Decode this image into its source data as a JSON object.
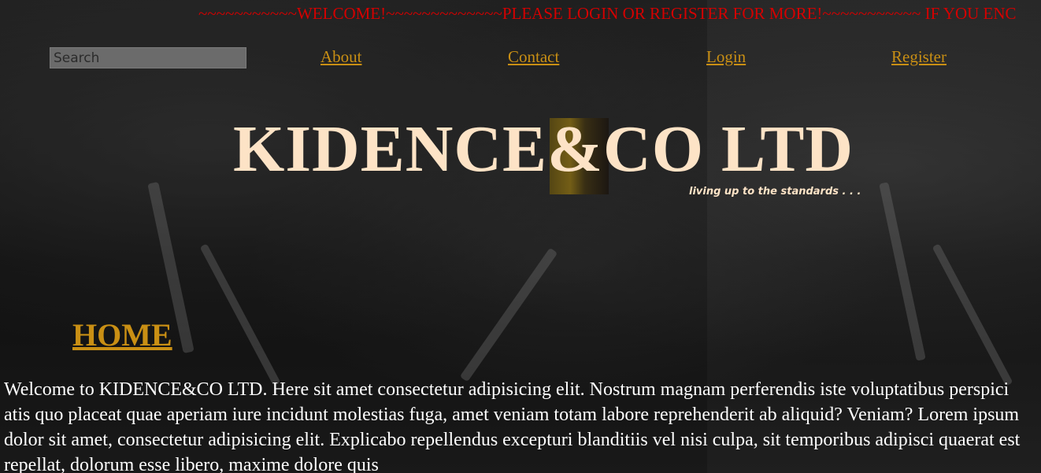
{
  "marquee": {
    "text": "~~~~~~~~~~~WELCOME!~~~~~~~~~~~~~PLEASE LOGIN OR REGISTER FOR MORE!~~~~~~~~~~~ IF YOU ENC"
  },
  "search": {
    "placeholder": "Search",
    "value": ""
  },
  "nav": {
    "items": [
      {
        "label": "About"
      },
      {
        "label": "Contact"
      },
      {
        "label": "Login"
      },
      {
        "label": "Register"
      }
    ]
  },
  "brand": {
    "name": "KIDENCE&CO LTD",
    "tagline": "living up to the standards . . ."
  },
  "main": {
    "heading": "HOME",
    "intro": "Welcome to KIDENCE&CO LTD. Here sit amet consectetur adipisicing elit. Nostrum magnam perferendis iste voluptatibus perspici atis quo placeat quae aperiam iure incidunt molestias fuga, amet veniam totam labore reprehenderit ab aliquid? Veniam? Lorem ipsum dolor sit amet, consectetur adipisicing elit. Explicabo repellendus excepturi blanditiis vel nisi culpa, sit temporibus adipisci quaerat est repellat, dolorum esse libero, maxime dolore quis"
  },
  "colors": {
    "marquee": "#d40000",
    "nav_link": "#c98f14",
    "brand": "#fde3c6",
    "background": "#1a1a1a"
  }
}
